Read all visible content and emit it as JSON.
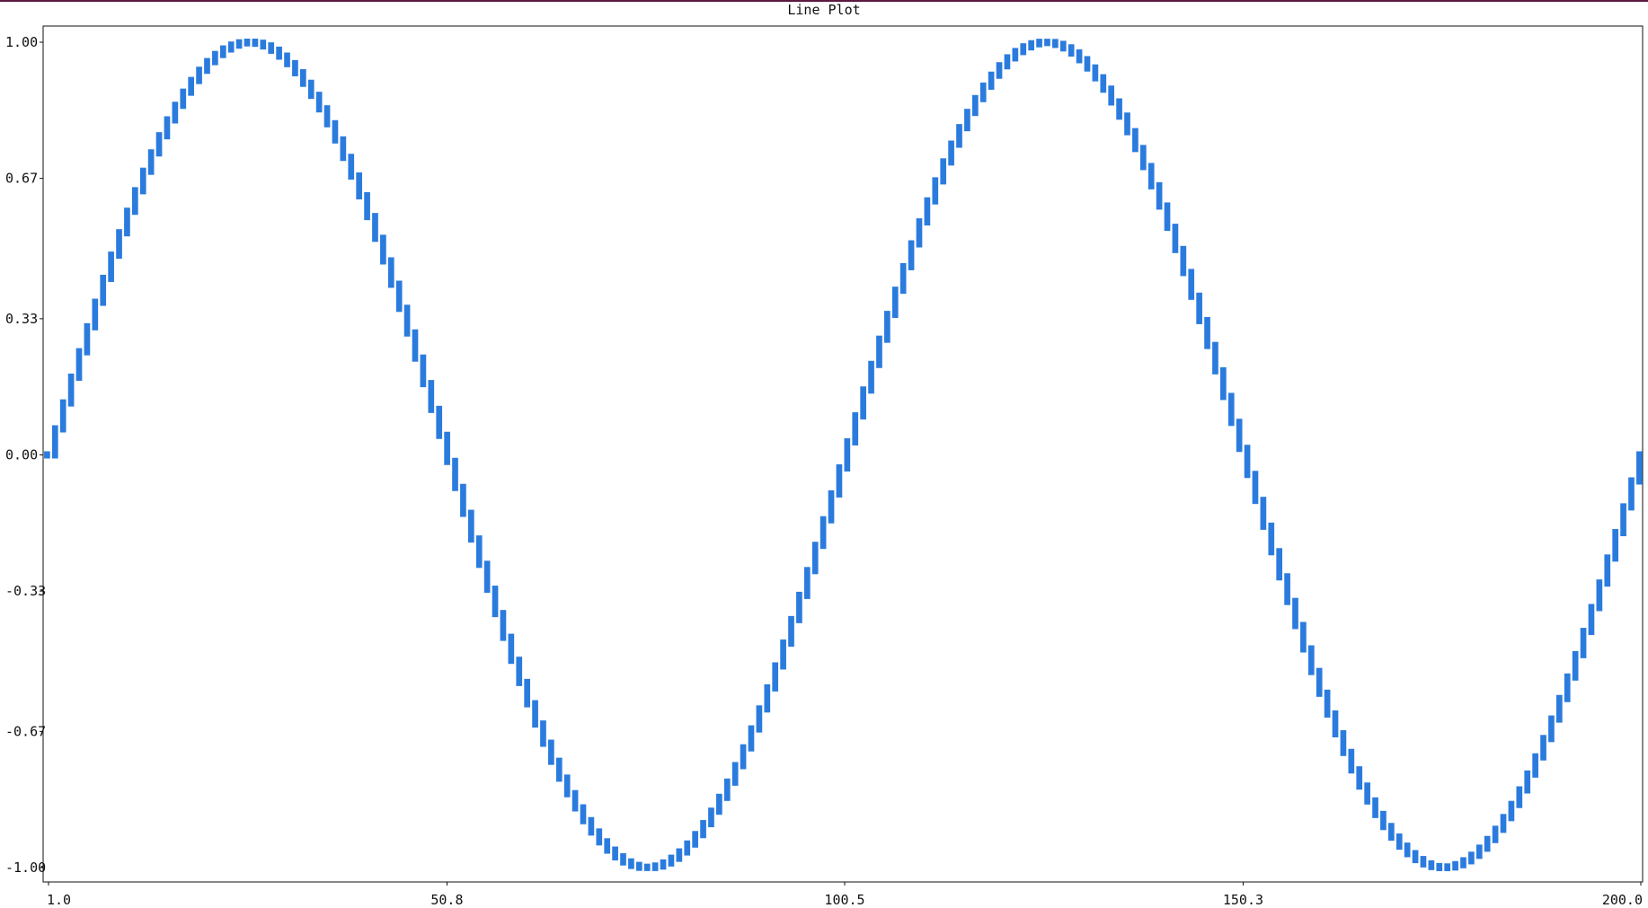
{
  "chart_data": {
    "type": "line",
    "title": "Line Plot",
    "xlabel": "",
    "ylabel": "",
    "xlim": [
      1.0,
      200.0
    ],
    "ylim": [
      -1.0,
      1.0
    ],
    "x_ticks": [
      "1.0",
      "50.8",
      "100.5",
      "150.3",
      "200.0"
    ],
    "y_ticks": [
      "1.00",
      "0.67",
      "0.33",
      "0.00",
      "-0.33",
      "-0.67",
      "-1.00"
    ],
    "grid": false,
    "series": [
      {
        "color": "#2b7bde",
        "function": "sine",
        "periods": 2,
        "x_start": 1.0,
        "x_end": 200.0,
        "points": 200
      }
    ]
  },
  "colors": {
    "line": "#2b7bde",
    "axis": "#111111",
    "top_strip": "#5a1a40"
  }
}
